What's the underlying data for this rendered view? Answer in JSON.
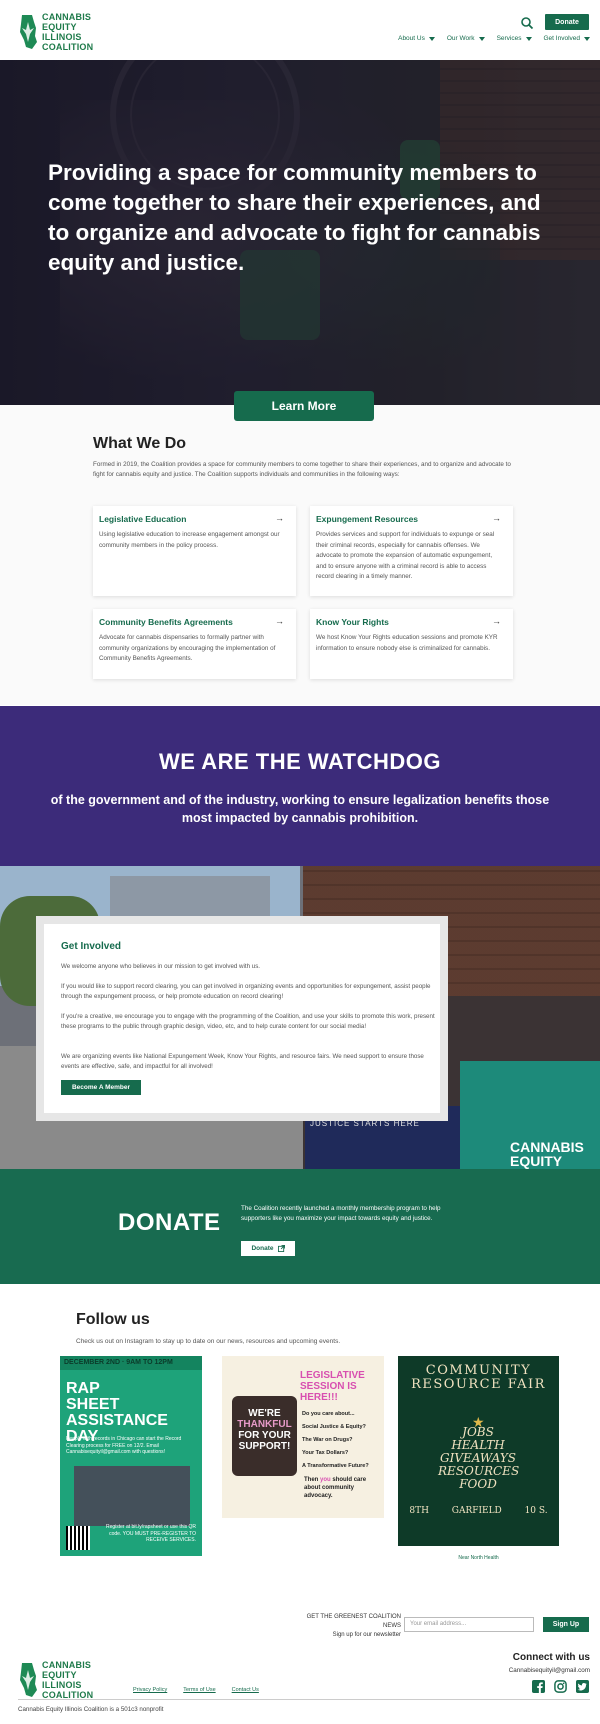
{
  "header": {
    "logo_lines": [
      "CANNABIS",
      "EQUITY",
      "ILLINOIS",
      "COALITION"
    ],
    "donate_label": "Donate",
    "nav": [
      {
        "label": "About Us"
      },
      {
        "label": "Our Work"
      },
      {
        "label": "Services"
      },
      {
        "label": "Get Involved"
      }
    ]
  },
  "hero": {
    "heading": "Providing a space for community members to come together to share their experiences, and to organize and advocate to fight for cannabis equity and justice.",
    "cta_label": "Learn More"
  },
  "what_we_do": {
    "title": "What We Do",
    "intro": "Formed in 2019, the Coalition provides a space for community members to come together to share their experiences, and to organize and advocate to fight for cannabis equity and justice. The Coalition supports individuals and communities in the following ways:",
    "cards": [
      {
        "title": "Legislative Education",
        "text": "Using legislative education to increase engagement amongst our community members in the policy process."
      },
      {
        "title": "Expungement Resources",
        "text": "Provides services and support for individuals to expunge or seal their criminal records, especially for cannabis offenses. We advocate to promote the expansion of automatic expungement, and to ensure anyone with a criminal record is able to access record clearing in a timely manner."
      },
      {
        "title": "Community Benefits Agreements",
        "text": "Advocate for cannabis dispensaries to formally partner with community organizations by encouraging the implementation of Community Benefits Agreements."
      },
      {
        "title": "Know Your Rights",
        "text": "We host Know Your Rights education sessions and promote KYR information to ensure nobody else is criminalized for cannabis."
      }
    ],
    "arrow": "→"
  },
  "watchdog": {
    "title": "WE ARE THE WATCHDOG",
    "subtitle": "of the government and of the industry, working to ensure legalization benefits those most impacted by cannabis prohibition."
  },
  "get_involved": {
    "title": "Get Involved",
    "paragraphs": [
      "We welcome anyone who believes in our mission to get involved with us.",
      "If you would like to support record clearing, you can get involved in organizing events and opportunities for expungement, assist people through the expungement process, or help promote education on record clearing!",
      "If you're a creative, we encourage you to engage with the programming of the Coalition, and use your skills to promote this work, present these programs to the public through graphic design, video, etc, and to help curate content for our social media!",
      "We are organizing events like National Expungement Week, Know Your Rights, and resource fairs. We need support to ensure those events are effective, safe, and impactful for all involved!"
    ],
    "button_label": "Become A Member",
    "photo_text": "JUSTICE STARTS HERE",
    "photo_sign": [
      "CANNABIS",
      "EQUITY"
    ]
  },
  "donate": {
    "title": "DONATE",
    "text": "The Coalition recently launched a monthly membership program to help supporters like you maximize your impact towards equity and justice.",
    "button_label": "Donate"
  },
  "follow": {
    "title": "Follow us",
    "text": "Check us out on Instagram to stay up to date on our news, resources and upcoming events.",
    "post1": {
      "date": "DECEMBER 2ND · 9AM TO 12PM",
      "title": "RAP SHEET ASSISTANCE DAY",
      "body": "People with records in Chicago can start the Record Clearing process for FREE on 12/2. Email Cannabisequityil@gmail.com with questions!",
      "footer": "Register at bit.ly/rapsheet or use this QR code. YOU MUST PRE-REGISTER TO RECEIVE SERVICES."
    },
    "post2": {
      "title": "LEGISLATIVE SESSION IS HERE!!!",
      "quote_a": "WE'RE",
      "quote_b": "THANKFUL",
      "quote_c": "FOR YOUR SUPPORT!",
      "questions": [
        "Do you care about...",
        "Social Justice & Equity?",
        "The War on Drugs?",
        "Your Tax Dollars?",
        "A Transformative Future?"
      ],
      "footer_a": "Then",
      "footer_b": "you",
      "footer_c": "should care about community advocacy."
    },
    "post3": {
      "title": "COMMUNITY RESOURCE FAIR",
      "words": "JOBS HEALTH GIVEAWAYS RESOURCES FOOD",
      "info": [
        "8TH",
        "GARFIELD",
        "10 S."
      ],
      "sponsor": "Near North Health"
    }
  },
  "newsletter": {
    "label_a": "GET THE GREENEST COALITION NEWS",
    "label_b": "Sign up for our newsletter",
    "placeholder": "Your email address...",
    "button_label": "Sign Up"
  },
  "footer": {
    "links": [
      "Privacy Policy",
      "Terms of Use",
      "Contact Us"
    ],
    "connect_title": "Connect with us",
    "email": "Cannabisequityil@gmail.com",
    "copyright": "Cannabis Equity Illinois Coalition is a 501c3 nonprofit"
  },
  "colors": {
    "brand_green": "#166b4d",
    "watchdog_purple": "#3c2b7a"
  },
  "icons": [
    "search-icon",
    "arrow-right-icon",
    "external-link-icon",
    "facebook-icon",
    "instagram-icon",
    "twitter-icon",
    "illinois-leaf-icon"
  ]
}
